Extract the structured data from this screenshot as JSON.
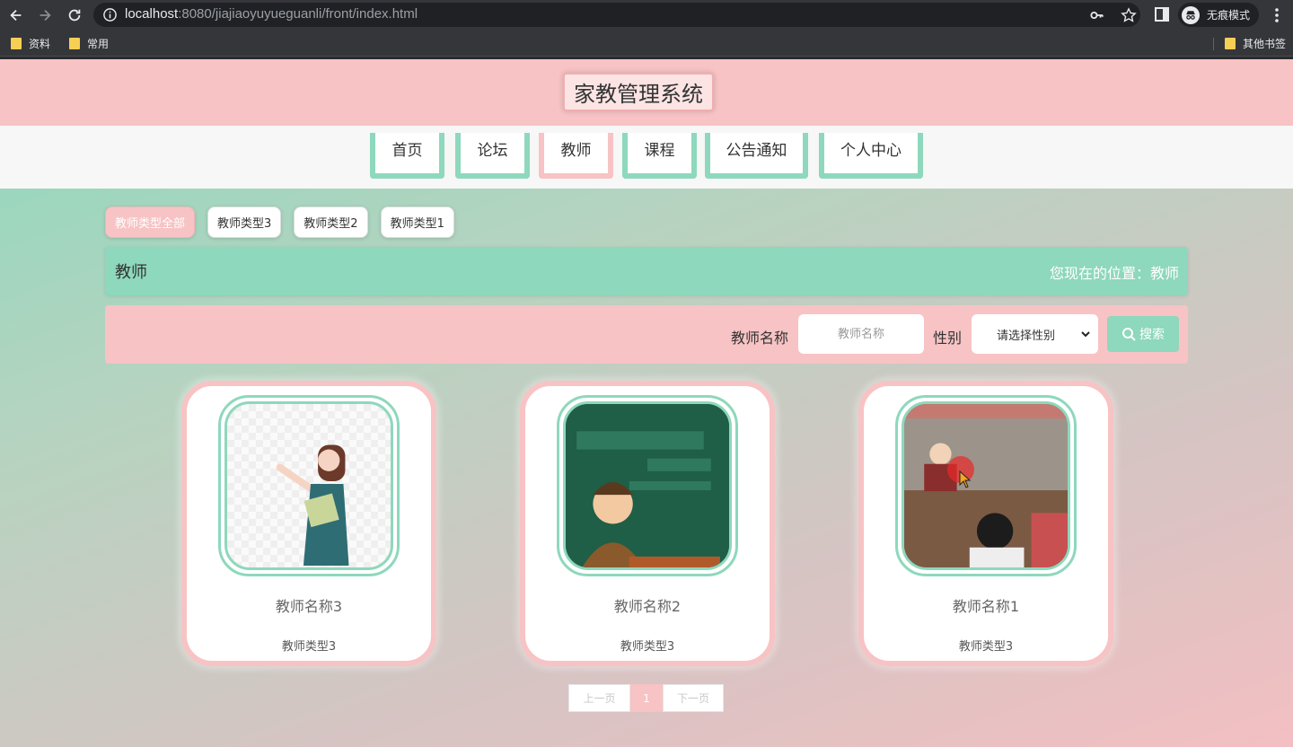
{
  "browser": {
    "url_host": "localhost",
    "url_rest": ":8080/jiajiaoyuyueguanli/front/index.html",
    "incognito_label": "无痕模式",
    "bookmarks": [
      "资料",
      "常用"
    ],
    "other_bookmarks": "其他书签"
  },
  "site": {
    "title": "家教管理系统"
  },
  "nav": {
    "items": [
      "首页",
      "论坛",
      "教师",
      "课程",
      "公告通知",
      "个人中心"
    ],
    "active_index": 2
  },
  "filters": {
    "items": [
      "教师类型全部",
      "教师类型3",
      "教师类型2",
      "教师类型1"
    ],
    "active_index": 0
  },
  "section": {
    "title": "教师",
    "breadcrumb": "您现在的位置：教师"
  },
  "search": {
    "name_label": "教师名称",
    "name_placeholder": "教师名称",
    "gender_label": "性别",
    "gender_selected": "请选择性别",
    "button_label": "搜索"
  },
  "cards": [
    {
      "name": "教师名称3",
      "type": "教师类型3"
    },
    {
      "name": "教师名称2",
      "type": "教师类型3"
    },
    {
      "name": "教师名称1",
      "type": "教师类型3"
    }
  ],
  "pagination": {
    "prev": "上一页",
    "current": "1",
    "next": "下一页"
  },
  "colors": {
    "mint": "#8ed8bd",
    "pink": "#f7c3c4"
  }
}
